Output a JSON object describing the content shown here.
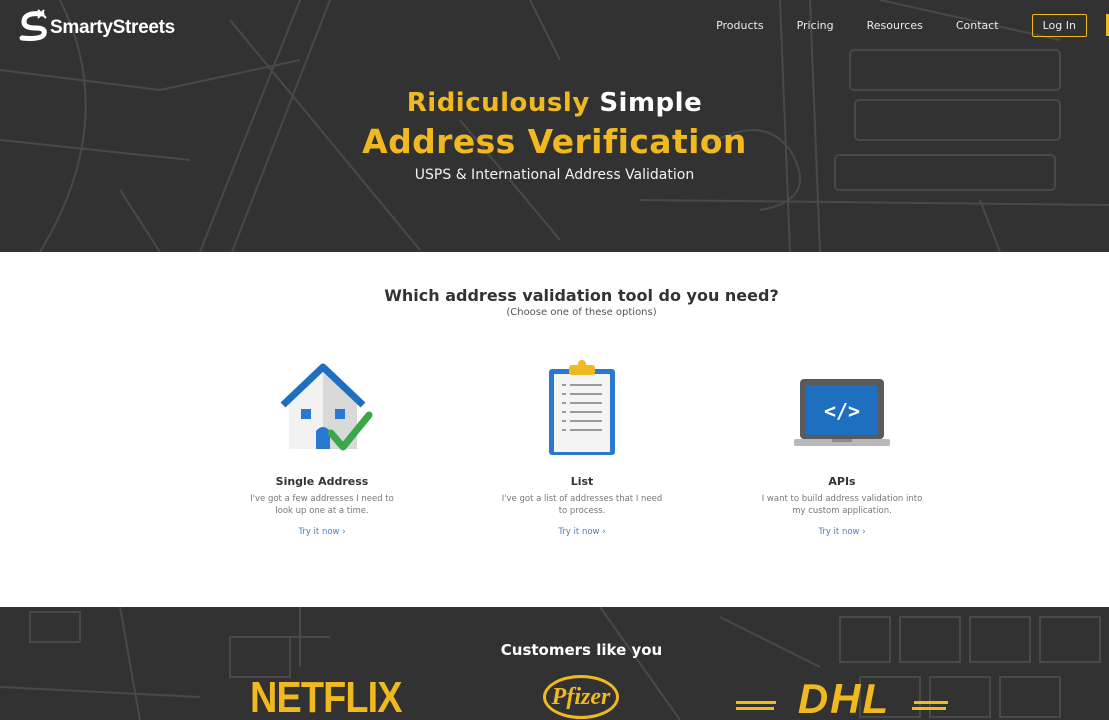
{
  "header": {
    "brand": "SmartyStreets",
    "nav": [
      "Products",
      "Pricing",
      "Resources",
      "Contact"
    ],
    "login_label": "Log In"
  },
  "hero": {
    "title_part1": "Ridiculously",
    "title_part2": "Simple",
    "title_line2": "Address Verification",
    "tagline": "USPS & International Address Validation"
  },
  "tools": {
    "question": "Which address validation tool do you need?",
    "subtitle": "(Choose one of these options)",
    "cards": [
      {
        "icon": "house-check-icon",
        "title": "Single Address",
        "desc": "I've got a few addresses I need to look up one at a time.",
        "link": "Try it now ›"
      },
      {
        "icon": "clipboard-list-icon",
        "title": "List",
        "desc": "I've got a list of addresses that I need to process.",
        "link": "Try it now ›"
      },
      {
        "icon": "laptop-code-icon",
        "title": "APIs",
        "desc": "I want to build address validation into my custom application.",
        "link": "Try it now ›"
      }
    ]
  },
  "customers": {
    "title": "Customers like you",
    "logos": [
      "NETFLIX",
      "Pfizer",
      "DHL"
    ]
  },
  "colors": {
    "accent": "#f0b91f",
    "dark_bg": "#333232",
    "link": "#4a7fc1"
  }
}
